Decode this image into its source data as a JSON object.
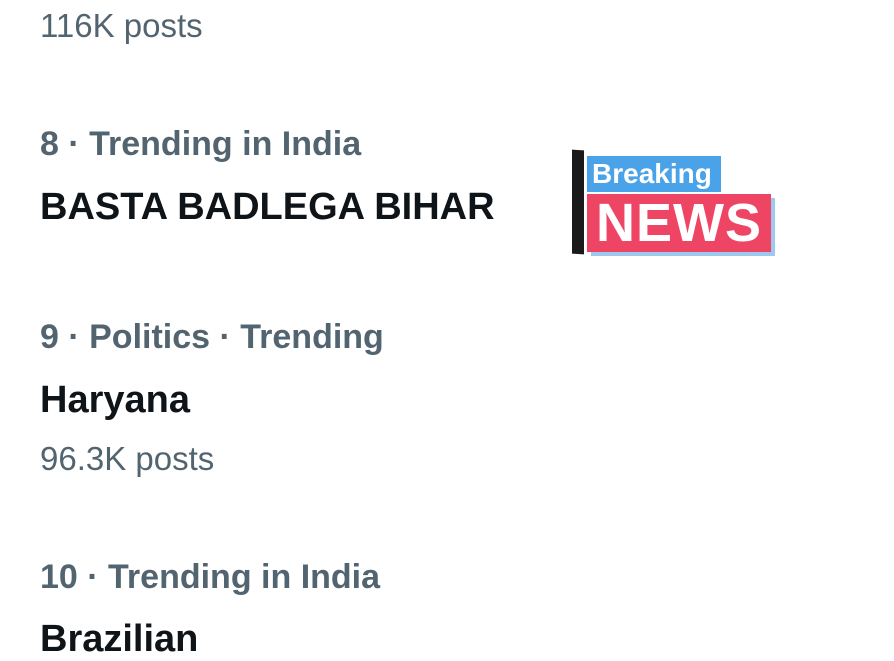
{
  "trends": [
    {
      "posts": "116K posts"
    },
    {
      "meta": "8 · Trending in India",
      "title": "BASTA BADLEGA BIHAR"
    },
    {
      "meta": "9 · Politics · Trending",
      "title": "Haryana",
      "posts": "96.3K posts"
    },
    {
      "meta": "10 · Trending in India",
      "title": "Brazilian"
    }
  ],
  "sticker": {
    "top_text": "Breaking",
    "bottom_text": "NEWS",
    "colors": {
      "pole": "#1a1a1a",
      "top_bg": "#4aa3e8",
      "bottom_bg": "#ef4564",
      "bottom_shadow": "#9fc8ef",
      "text": "#ffffff"
    }
  },
  "colors": {
    "meta_text": "#536471",
    "title_text": "#0f1419",
    "background": "#ffffff"
  }
}
